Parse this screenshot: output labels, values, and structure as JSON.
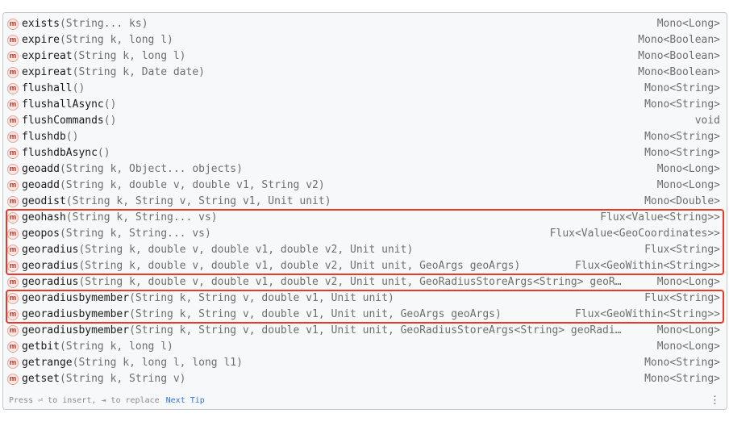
{
  "completion": {
    "items": [
      {
        "name": "exists",
        "params": "(String... ks)",
        "ret": "Mono<Long>"
      },
      {
        "name": "expire",
        "params": "(String k, long l)",
        "ret": "Mono<Boolean>"
      },
      {
        "name": "expireat",
        "params": "(String k, long l)",
        "ret": "Mono<Boolean>"
      },
      {
        "name": "expireat",
        "params": "(String k, Date date)",
        "ret": "Mono<Boolean>"
      },
      {
        "name": "flushall",
        "params": "()",
        "ret": "Mono<String>"
      },
      {
        "name": "flushallAsync",
        "params": "()",
        "ret": "Mono<String>"
      },
      {
        "name": "flushCommands",
        "params": "()",
        "ret": "void"
      },
      {
        "name": "flushdb",
        "params": "()",
        "ret": "Mono<String>"
      },
      {
        "name": "flushdbAsync",
        "params": "()",
        "ret": "Mono<String>"
      },
      {
        "name": "geoadd",
        "params": "(String k, Object... objects)",
        "ret": "Mono<Long>"
      },
      {
        "name": "geoadd",
        "params": "(String k, double v, double v1, String v2)",
        "ret": "Mono<Long>"
      },
      {
        "name": "geodist",
        "params": "(String k, String v, String v1, Unit unit)",
        "ret": "Mono<Double>"
      },
      {
        "name": "geohash",
        "params": "(String k, String... vs)",
        "ret": "Flux<Value<String>>"
      },
      {
        "name": "geopos",
        "params": "(String k, String... vs)",
        "ret": "Flux<Value<GeoCoordinates>>"
      },
      {
        "name": "georadius",
        "params": "(String k, double v, double v1, double v2, Unit unit)",
        "ret": "Flux<String>"
      },
      {
        "name": "georadius",
        "params": "(String k, double v, double v1, double v2, Unit unit, GeoArgs geoArgs)",
        "ret": "Flux<GeoWithin<String>>"
      },
      {
        "name": "georadius",
        "params": "(String k, double v, double v1, double v2, Unit unit, GeoRadiusStoreArgs<String> geoR…",
        "ret": "Mono<Long>"
      },
      {
        "name": "georadiusbymember",
        "params": "(String k, String v, double v1, Unit unit)",
        "ret": "Flux<String>"
      },
      {
        "name": "georadiusbymember",
        "params": "(String k, String v, double v1, Unit unit, GeoArgs geoArgs)",
        "ret": "Flux<GeoWithin<String>>"
      },
      {
        "name": "georadiusbymember",
        "params": "(String k, String v, double v1, Unit unit, GeoRadiusStoreArgs<String> geoRadi…",
        "ret": "Mono<Long>"
      },
      {
        "name": "getbit",
        "params": "(String k, long l)",
        "ret": "Mono<Long>"
      },
      {
        "name": "getrange",
        "params": "(String k, long l, long l1)",
        "ret": "Mono<String>"
      },
      {
        "name": "getset",
        "params": "(String k, String v)",
        "ret": "Mono<String>"
      }
    ],
    "badge_letter": "m",
    "footer_hint": "Press ⏎ to insert, ⇥ to replace",
    "footer_tip": "Next Tip",
    "more_icon": "⋮",
    "highlight_color": "#e83a24"
  }
}
